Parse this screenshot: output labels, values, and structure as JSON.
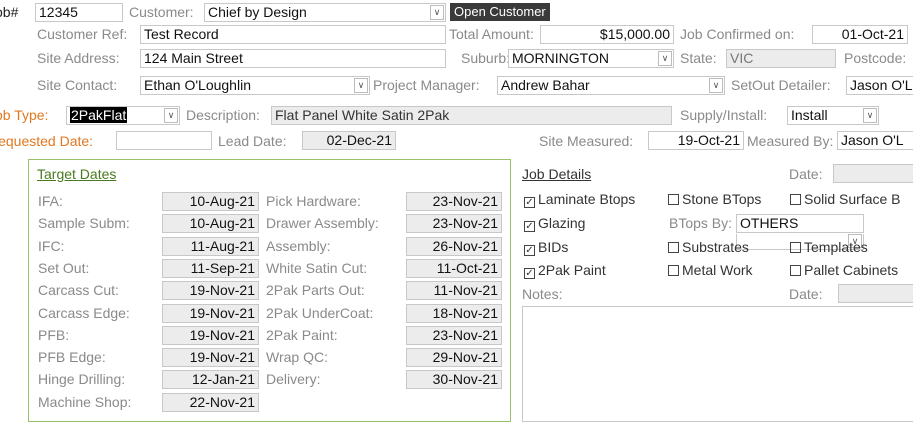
{
  "header": {
    "job_label": "Job#",
    "job_number": "12345",
    "customer_label": "Customer:",
    "customer": "Chief by Design",
    "open_customer_button": "Open Customer",
    "customer_ref_label": "Customer Ref:",
    "customer_ref": "Test Record",
    "total_amount_label": "Total Amount:",
    "total_amount": "$15,000.00",
    "job_confirmed_label": "Job Confirmed on:",
    "job_confirmed": "01-Oct-21",
    "site_address_label": "Site Address:",
    "site_address": "124 Main Street",
    "suburb_label": "Suburb:",
    "suburb": "MORNINGTON",
    "state_label": "State:",
    "state": "VIC",
    "postcode_label": "Postcode:",
    "site_contact_label": "Site Contact:",
    "site_contact": "Ethan O'Loughlin",
    "project_manager_label": "Project Manager:",
    "project_manager": "Andrew Bahar",
    "setout_detailer_label": "SetOut Detailer:",
    "setout_detailer": "Jason O'L",
    "job_type_label": "Job Type:",
    "job_type": "2PakFlat",
    "description_label": "Description:",
    "description": "Flat Panel White Satin 2Pak",
    "supply_install_label": "Supply/Install:",
    "supply_install": "Install",
    "requested_date_label": "Requested Date:",
    "lead_date_label": "Lead Date:",
    "lead_date": "02-Dec-21",
    "site_measured_label": "Site Measured:",
    "site_measured": "19-Oct-21",
    "measured_by_label": "Measured By:",
    "measured_by": "Jason O'L"
  },
  "target_dates": {
    "title": "Target Dates",
    "left": [
      {
        "label": "IFA:",
        "value": "10-Aug-21"
      },
      {
        "label": "Sample Subm:",
        "value": "10-Aug-21"
      },
      {
        "label": "IFC:",
        "value": "11-Aug-21"
      },
      {
        "label": "Set Out:",
        "value": "11-Sep-21"
      },
      {
        "label": "Carcass Cut:",
        "value": "19-Nov-21"
      },
      {
        "label": "Carcass Edge:",
        "value": "19-Nov-21"
      },
      {
        "label": "PFB:",
        "value": "19-Nov-21"
      },
      {
        "label": "PFB Edge:",
        "value": "19-Nov-21"
      },
      {
        "label": "Hinge Drilling:",
        "value": "12-Jan-21"
      },
      {
        "label": "Machine Shop:",
        "value": "22-Nov-21"
      }
    ],
    "right": [
      {
        "label": "Pick Hardware:",
        "value": "23-Nov-21"
      },
      {
        "label": "Drawer Assembly:",
        "value": "23-Nov-21"
      },
      {
        "label": "Assembly:",
        "value": "26-Nov-21"
      },
      {
        "label": "White Satin Cut:",
        "value": "11-Oct-21"
      },
      {
        "label": "2Pak Parts Out:",
        "value": "11-Nov-21"
      },
      {
        "label": "2Pak UnderCoat:",
        "value": "18-Nov-21"
      },
      {
        "label": "2Pak Paint:",
        "value": "23-Nov-21"
      },
      {
        "label": "Wrap QC:",
        "value": "29-Nov-21"
      },
      {
        "label": "Delivery:",
        "value": "30-Nov-21"
      }
    ]
  },
  "job_details": {
    "title": "Job Details",
    "date_label": "Date:",
    "laminate_btops": "Laminate Btops",
    "stone_btops": "Stone BTops",
    "solid_surface": "Solid Surface B",
    "glazing": "Glazing",
    "btops_by_label": "BTops By:",
    "btops_by": "OTHERS",
    "bids": "BIDs",
    "substrates": "Substrates",
    "templates": "Templates",
    "twopak_paint": "2Pak Paint",
    "metal_work": "Metal Work",
    "pallet_cabinets": "Pallet Cabinets",
    "notes_label": "Notes:",
    "notes_date_label": "Date:"
  }
}
